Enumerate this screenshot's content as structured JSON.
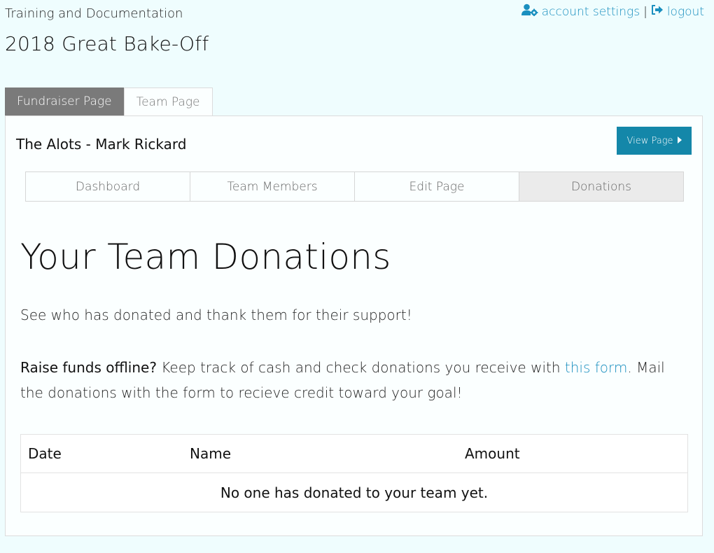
{
  "header": {
    "org_name": "Training and Documentation",
    "event_title": "2018 Great Bake-Off",
    "account_settings_label": "account settings",
    "separator": "|",
    "logout_label": "logout"
  },
  "tabs": [
    {
      "label": "Fundraiser Page"
    },
    {
      "label": "Team Page"
    }
  ],
  "team": {
    "name": "The Alots - Mark Rickard",
    "view_page_label": "View Page"
  },
  "subnav": [
    {
      "label": "Dashboard"
    },
    {
      "label": "Team Members"
    },
    {
      "label": "Edit Page"
    },
    {
      "label": "Donations",
      "active": true
    }
  ],
  "main": {
    "heading": "Your Team Donations",
    "intro": "See who has donated and thank them for their support!",
    "offline_bold": "Raise funds offline?",
    "offline_text_before_link": " Keep track of cash and check donations you receive with ",
    "offline_link": "this form",
    "offline_text_after_link": ". Mail the donations with the form to recieve credit toward your goal!"
  },
  "table": {
    "columns": [
      "Date",
      "Name",
      "Amount"
    ],
    "empty_message": "No one has donated to your team yet."
  },
  "colors": {
    "background": "#effdfe",
    "link": "#1a8fbf",
    "button": "#1487a9",
    "tab_dark": "#7a7a7a"
  },
  "icons": {
    "account": "user-gear-icon",
    "logout": "sign-out-icon",
    "view_page": "caret-right-icon"
  }
}
